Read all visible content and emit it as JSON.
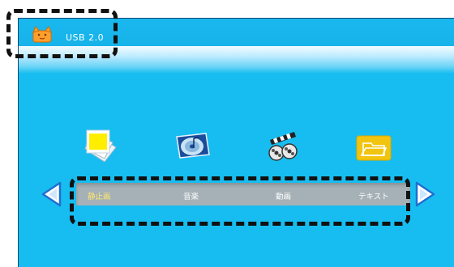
{
  "header": {
    "device_label": "USB 2.0",
    "device_icon": "usb-drive-icon"
  },
  "categories": [
    {
      "label": "静止画",
      "icon": "photo-icon",
      "selected": true
    },
    {
      "label": "音楽",
      "icon": "music-cd-icon",
      "selected": false
    },
    {
      "label": "動画",
      "icon": "video-clapper-icon",
      "selected": false
    },
    {
      "label": "テキスト",
      "icon": "folder-icon",
      "selected": false
    }
  ],
  "nav": {
    "prev_icon": "arrow-left-icon",
    "next_icon": "arrow-right-icon"
  },
  "colors": {
    "background": "#17bdf0",
    "selected_label": "#ffe76a",
    "bar": "#a6b1b7",
    "arrow": "#1f6fd0"
  }
}
